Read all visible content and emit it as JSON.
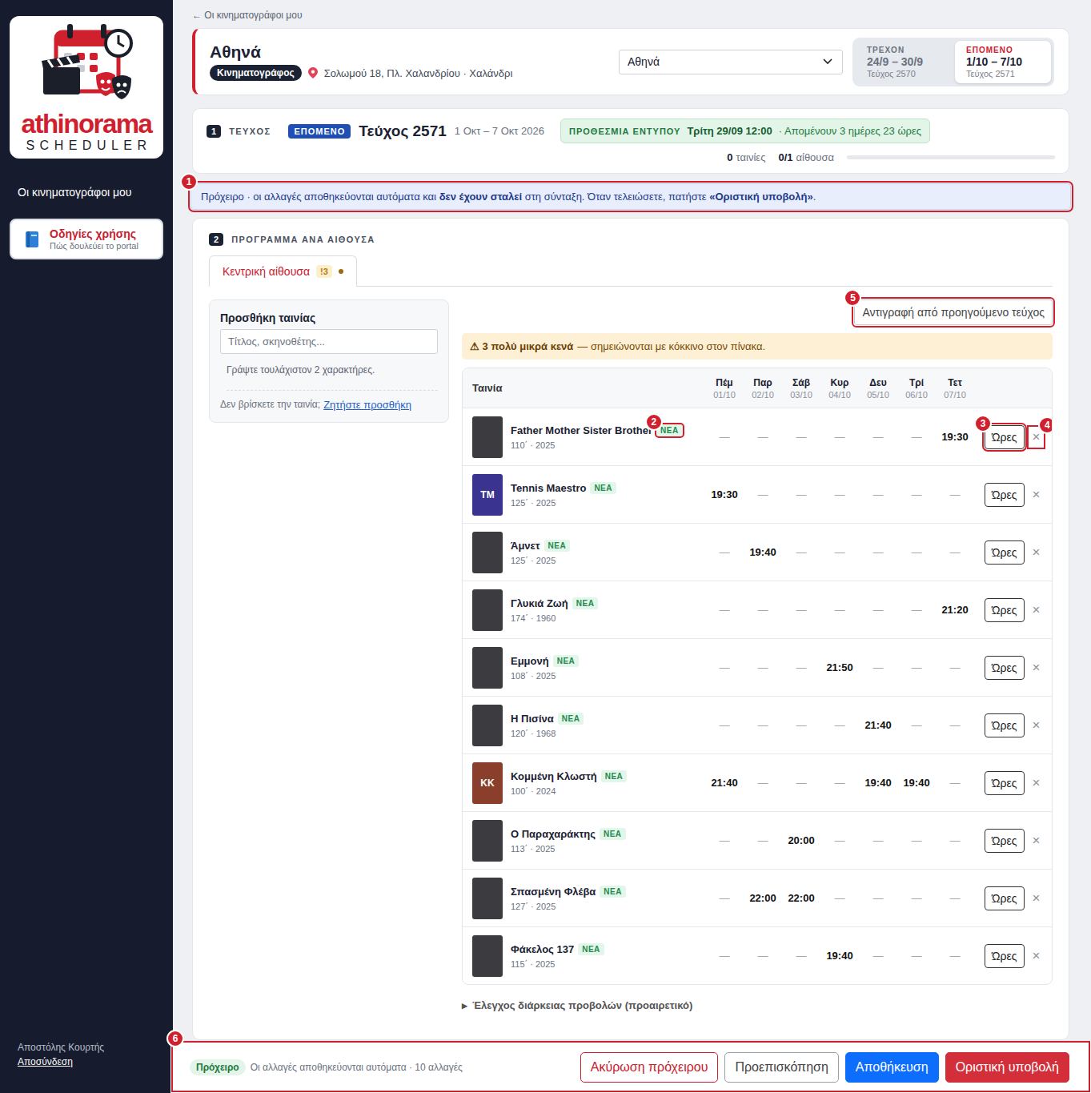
{
  "sidebar": {
    "logo": {
      "word": "athinorama",
      "sub": "SCHEDULER"
    },
    "nav": [
      {
        "label": "Οι κινηματογράφοι μου",
        "selected": false
      }
    ],
    "help": {
      "title": "Οδηγίες χρήσης",
      "subtitle": "Πώς δουλεύει το portal"
    },
    "user": {
      "name": "Αποστόλης Κουρτής",
      "logout": "Αποσύνδεση"
    }
  },
  "back_link": "← Οι κινηματογράφοι μου",
  "cinema": {
    "name": "Αθηνά",
    "type": "Κινηματογράφος",
    "address": "Σολωμού 18, Πλ. Χαλανδρίου · Χαλάνδρι",
    "select": "Αθηνά",
    "issues": [
      {
        "label": "ΤΡΕΧΟΝ",
        "range": "24/9 – 30/9",
        "issue": "Τεύχος 2570",
        "selected": false
      },
      {
        "label": "ΕΠΟΜΕΝΟ",
        "range": "1/10 – 7/10",
        "issue": "Τεύχος 2571",
        "selected": true
      }
    ]
  },
  "issue_card": {
    "step": "1",
    "label": "ΤΕΥΧΟΣ",
    "badge": "ΕΠΟΜΕΝΟ",
    "title": "Τεύχος 2571",
    "range": "1 Οκτ – 7 Οκτ 2026",
    "deadline": {
      "label": "ΠΡΟΘΕΣΜΙΑ ΕΝΤΥΠΟΥ",
      "date": "Τρίτη 29/09 12:00",
      "remaining": "· Απομένουν 3 ημέρες 23 ώρες"
    },
    "stats": [
      {
        "value": "0",
        "label": "ταινίες"
      },
      {
        "value": "0/1",
        "label": "αίθουσα"
      }
    ],
    "level": 0
  },
  "notice": {
    "marker": "1",
    "segments": [
      {
        "text": "Πρόχειρο · οι αλλαγές αποθηκεύονται αυτόματα και ",
        "bold": false
      },
      {
        "text": "δεν έχουν σταλεί",
        "bold": true
      },
      {
        "text": " στη σύνταξη. Όταν τελειώσετε, πατήστε ",
        "bold": false
      },
      {
        "text": "«Οριστική υποβολή»",
        "bold": true
      },
      {
        "text": ".",
        "bold": false
      }
    ]
  },
  "schedule": {
    "step": "2",
    "label": "ΠΡΟΓΡΑΜΜΑ ΑΝΑ ΑΙΘΟΥΣΑ",
    "tabs": [
      {
        "label": "Κεντρική αίθουσα",
        "alert": "!3",
        "dot": true,
        "selected": true
      }
    ],
    "add_panel": {
      "title": "Προσθήκη ταινίας",
      "placeholder": "Τίτλος, σκηνοθέτης...",
      "hint": "Γράψτε τουλάχιστον 2 χαρακτήρες.",
      "missing": "Δεν βρίσκετε την ταινία;",
      "request": "Ζητήστε προσθήκη"
    },
    "copy_button": {
      "label": "Αντιγραφή από προηγούμενο τεύχος",
      "marker": "5"
    },
    "warning": {
      "icon": "⚠",
      "strong": "3 πολύ μικρά κενά",
      "text": "— σημειώνονται με κόκκινο στον πίνακα."
    },
    "table": {
      "film_column": "Ταινία",
      "days": [
        {
          "day": "Πέμ",
          "date": "01/10"
        },
        {
          "day": "Παρ",
          "date": "02/10"
        },
        {
          "day": "Σάβ",
          "date": "03/10"
        },
        {
          "day": "Κυρ",
          "date": "04/10"
        },
        {
          "day": "Δευ",
          "date": "05/10"
        },
        {
          "day": "Τρί",
          "date": "06/10"
        },
        {
          "day": "Τετ",
          "date": "07/10"
        }
      ],
      "empty_mark": "—",
      "rows": [
        {
          "title": "Father Mother Sister Brother",
          "badge": "ΝΕΑ",
          "meta": "110΄ · 2025",
          "kind": "photo",
          "cells": [
            null,
            null,
            null,
            null,
            null,
            null,
            "19:30"
          ],
          "hours": "Ώρες",
          "remove": "×",
          "badge_marker": "2",
          "hours_marker": "3",
          "remove_marker": "4"
        },
        {
          "title": "Tennis Maestro",
          "badge": "ΝΕΑ",
          "meta": "125΄ · 2025",
          "kind": "initials",
          "initials": "TM",
          "color": "#3a338f",
          "cells": [
            "19:30",
            null,
            null,
            null,
            null,
            null,
            null
          ],
          "hours": "Ώρες",
          "remove": "×"
        },
        {
          "title": "Άμνετ",
          "badge": "ΝΕΑ",
          "meta": "125΄ · 2025",
          "kind": "photo",
          "cells": [
            null,
            "19:40",
            null,
            null,
            null,
            null,
            null
          ],
          "hours": "Ώρες",
          "remove": "×"
        },
        {
          "title": "Γλυκιά Ζωή",
          "badge": "ΝΕΑ",
          "meta": "174΄ · 1960",
          "kind": "photo",
          "cells": [
            null,
            null,
            null,
            null,
            null,
            null,
            "21:20"
          ],
          "hours": "Ώρες",
          "remove": "×"
        },
        {
          "title": "Εμμονή",
          "badge": "ΝΕΑ",
          "meta": "108΄ · 2025",
          "kind": "photo",
          "cells": [
            null,
            null,
            null,
            "21:50",
            null,
            null,
            null
          ],
          "hours": "Ώρες",
          "remove": "×"
        },
        {
          "title": "Η Πισίνα",
          "badge": "ΝΕΑ",
          "meta": "120΄ · 1968",
          "kind": "photo",
          "cells": [
            null,
            null,
            null,
            null,
            "21:40",
            null,
            null
          ],
          "hours": "Ώρες",
          "remove": "×"
        },
        {
          "title": "Κομμένη Κλωστή",
          "badge": "ΝΕΑ",
          "meta": "100΄ · 2024",
          "kind": "initials",
          "initials": "KK",
          "color": "#8a3f2d",
          "cells": [
            "21:40",
            null,
            null,
            null,
            "19:40",
            "19:40",
            null
          ],
          "hours": "Ώρες",
          "remove": "×"
        },
        {
          "title": "Ο Παραχαράκτης",
          "badge": "ΝΕΑ",
          "meta": "113΄ · 2025",
          "kind": "photo",
          "cells": [
            null,
            null,
            "20:00",
            null,
            null,
            null,
            null
          ],
          "hours": "Ώρες",
          "remove": "×"
        },
        {
          "title": "Σπασμένη Φλέβα",
          "badge": "ΝΕΑ",
          "meta": "127΄ · 2025",
          "kind": "photo",
          "cells": [
            null,
            "22:00",
            "22:00",
            null,
            null,
            null,
            null
          ],
          "hours": "Ώρες",
          "remove": "×"
        },
        {
          "title": "Φάκελος 137",
          "badge": "ΝΕΑ",
          "meta": "115΄ · 2025",
          "kind": "photo",
          "cells": [
            null,
            null,
            null,
            "19:40",
            null,
            null,
            null
          ],
          "hours": "Ώρες",
          "remove": "×"
        }
      ]
    },
    "expander": {
      "icon": "▶",
      "label": "Έλεγχος διάρκειας προβολών (προαιρετικό)",
      "expanded": false
    }
  },
  "footer": {
    "marker": "6",
    "status": "Πρόχειρο",
    "text": "Οι αλλαγές αποθηκεύονται αυτόματα · 10 αλλαγές",
    "buttons": [
      {
        "label": "Ακύρωση πρόχειρου",
        "kind": "cancel"
      },
      {
        "label": "Προεπισκόπηση",
        "kind": "preview"
      },
      {
        "label": "Αποθήκευση",
        "kind": "save"
      },
      {
        "label": "Οριστική υποβολή",
        "kind": "submit"
      }
    ]
  }
}
